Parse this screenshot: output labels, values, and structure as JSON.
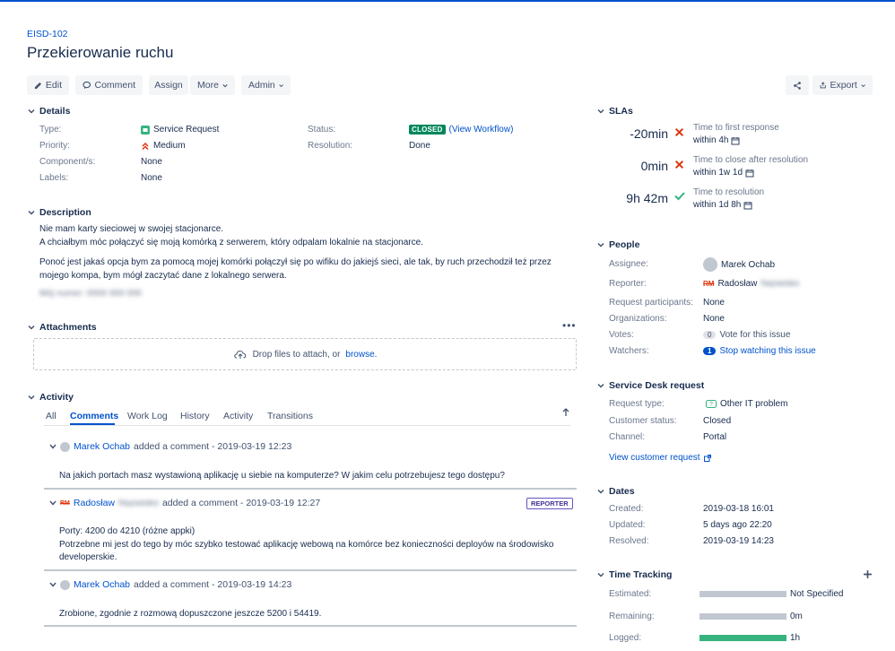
{
  "issue": {
    "key": "EISD-102",
    "title": "Przekierowanie ruchu"
  },
  "toolbar": {
    "edit": "Edit",
    "comment": "Comment",
    "assign": "Assign",
    "more": "More",
    "admin": "Admin",
    "export": "Export"
  },
  "details": {
    "heading": "Details",
    "type_label": "Type:",
    "type_value": "Service Request",
    "priority_label": "Priority:",
    "priority_value": "Medium",
    "components_label": "Component/s:",
    "components_value": "None",
    "labels_label": "Labels:",
    "labels_value": "None",
    "status_label": "Status:",
    "status_value": "CLOSED",
    "workflow_link": "(View Workflow)",
    "resolution_label": "Resolution:",
    "resolution_value": "Done"
  },
  "description": {
    "heading": "Description",
    "line1": "Nie mam karty sieciowej w swojej stacjonarce.",
    "line2": "A chciałbym móc połączyć się moją komórką z serwerem, który odpalam lokalnie na stacjonarce.",
    "line3": "Ponoć jest jakaś opcja bym za pomocą mojej komórki połączył się po wifiku do jakiejś sieci, ale tak, by ruch przechodził też przez",
    "line4": "mojego kompa, bym mógł zaczytać dane z lokalnego serwera.",
    "line5": "Mój numer: 0000 000 000"
  },
  "attachments": {
    "heading": "Attachments",
    "drop_text": "Drop files to attach, or",
    "browse": "browse."
  },
  "activity": {
    "heading": "Activity",
    "tabs": [
      "All",
      "Comments",
      "Work Log",
      "History",
      "Activity",
      "Transitions"
    ],
    "comments": [
      {
        "author": "Marek Ochab",
        "meta": "added a comment - 2019-03-19 12:23",
        "lines": [
          "Na jakich portach masz wystawioną aplikację u siebie na komputerze? W jakim celu potrzebujesz tego dostępu?"
        ]
      },
      {
        "author": "Radosław",
        "author_hidden": "Nazwisko",
        "meta": "added a comment - 2019-03-19 12:27",
        "badge": "REPORTER",
        "lines": [
          "Porty: 4200 do 4210 (różne appki)",
          "Potrzebne mi jest do tego by móc szybko testować aplikację webową na komórce bez konieczności deployów na środowisko",
          "developerskie."
        ]
      },
      {
        "author": "Marek Ochab",
        "meta": "added a comment - 2019-03-19 14:23",
        "lines": [
          "Zrobione, zgodnie z rozmową dopuszczone jeszcze 5200 i 54419."
        ]
      }
    ]
  },
  "slas": {
    "heading": "SLAs",
    "items": [
      {
        "time": "-20min",
        "name": "Time to first response",
        "goal": "within 4h",
        "met": false
      },
      {
        "time": "0min",
        "name": "Time to close after resolution",
        "goal": "within 1w 1d",
        "met": false
      },
      {
        "time": "9h 42m",
        "name": "Time to resolution",
        "goal": "within 1d 8h",
        "met": true
      }
    ]
  },
  "people": {
    "heading": "People",
    "assignee_label": "Assignee:",
    "assignee": "Marek Ochab",
    "reporter_label": "Reporter:",
    "reporter": "Radosław",
    "reporter_hidden": "Nazwisko",
    "participants_label": "Request participants:",
    "participants": "None",
    "organizations_label": "Organizations:",
    "organizations": "None",
    "votes_label": "Votes:",
    "votes_count": "0",
    "votes_link": "Vote for this issue",
    "watchers_label": "Watchers:",
    "watchers_count": "1",
    "watchers_link": "Stop watching this issue"
  },
  "service_desk": {
    "heading": "Service Desk request",
    "type_label": "Request type:",
    "type_value": "Other IT problem",
    "status_label": "Customer status:",
    "status_value": "Closed",
    "channel_label": "Channel:",
    "channel_value": "Portal",
    "view_link": "View customer request"
  },
  "dates": {
    "heading": "Dates",
    "created_label": "Created:",
    "created": "2019-03-18 16:01",
    "updated_label": "Updated:",
    "updated": "5 days ago 22:20",
    "resolved_label": "Resolved:",
    "resolved": "2019-03-19 14:23"
  },
  "time_tracking": {
    "heading": "Time Tracking",
    "estimated_label": "Estimated:",
    "estimated": "Not Specified",
    "estimated_fraction": 0,
    "remaining_label": "Remaining:",
    "remaining": "0m",
    "remaining_fraction": 0,
    "logged_label": "Logged:",
    "logged": "1h",
    "logged_fraction": 1
  },
  "colors": {
    "accent": "#0052cc",
    "closed": "#00875a",
    "breach": "#de350b",
    "met": "#36b37e"
  }
}
